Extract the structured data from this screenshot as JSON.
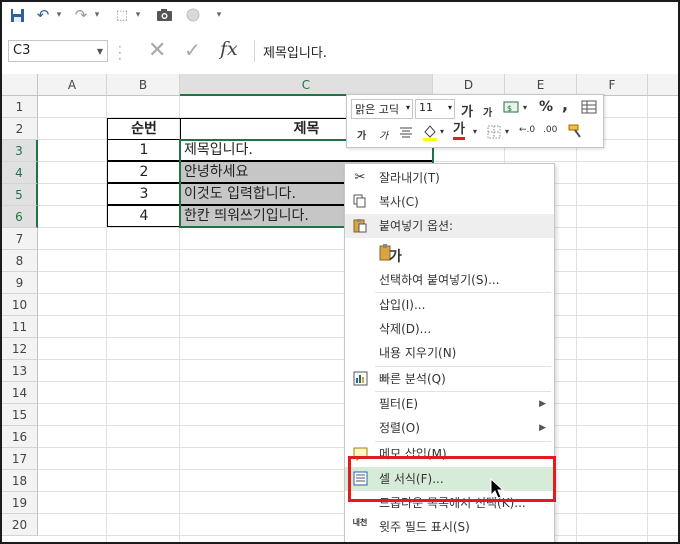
{
  "name_box": "C3",
  "formula": "제목입니다.",
  "columns": [
    "A",
    "B",
    "C",
    "D",
    "E",
    "F"
  ],
  "rows": [
    "1",
    "2",
    "3",
    "4",
    "5",
    "6",
    "7",
    "8",
    "9",
    "10",
    "11",
    "12",
    "13",
    "14",
    "15",
    "16",
    "17",
    "18",
    "19",
    "20"
  ],
  "table": {
    "header": [
      "순번",
      "제목"
    ],
    "rows": [
      [
        "1",
        "제목입니다."
      ],
      [
        "2",
        "안녕하세요"
      ],
      [
        "3",
        "이것도 입력합니다."
      ],
      [
        "4",
        "한칸 띄워쓰기입니다."
      ]
    ]
  },
  "mini_toolbar": {
    "font": "맑은 고딕",
    "size": "11",
    "grow": "가",
    "shrink": "가",
    "percent": "%",
    "comma": ",",
    "bold": "가",
    "italic": "가",
    "font_color": "가",
    "inc_dec": "←.0",
    "dec_dec": ".00"
  },
  "context_menu": [
    {
      "label": "잘라내기(T)",
      "icon": "scissors-icon"
    },
    {
      "label": "복사(C)",
      "icon": "copy-icon"
    },
    {
      "label": "붙여넣기 옵션:",
      "icon": "paste-icon",
      "header": true
    },
    {
      "label": "가",
      "icon": "paste-option-icon"
    },
    {
      "label": "선택하여 붙여넣기(S)..."
    },
    {
      "label": "삽입(I)..."
    },
    {
      "label": "삭제(D)..."
    },
    {
      "label": "내용 지우기(N)"
    },
    {
      "label": "빠른 분석(Q)",
      "icon": "quick-analysis-icon"
    },
    {
      "label": "필터(E)",
      "submenu": true
    },
    {
      "label": "정렬(O)",
      "submenu": true
    },
    {
      "label": "메모 삽입(M)",
      "icon": "comment-icon"
    },
    {
      "label": "셀 서식(F)...",
      "icon": "format-cells-icon",
      "highlight": true
    },
    {
      "label": "드롭다운 목록에서 선택(K)..."
    },
    {
      "label": "윗주 필드 표시(S)",
      "icon": "phonetic-icon"
    }
  ],
  "colors": {
    "excel_green": "#217346",
    "highlight": "#e21c1c"
  }
}
